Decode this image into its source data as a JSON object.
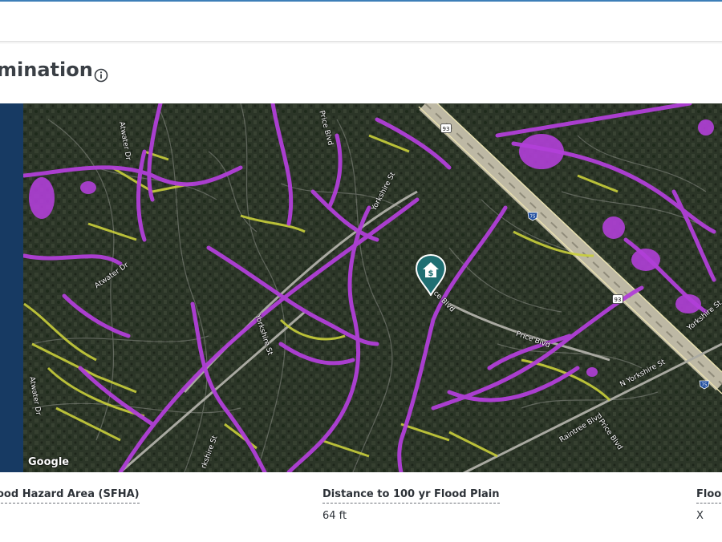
{
  "section": {
    "title": "mination"
  },
  "map": {
    "attribution": "Google",
    "road_labels": [
      "Atwater Dr",
      "Atwater Dr",
      "Atwater Dr",
      "Price Blvd",
      "Yorkshire St",
      "Yorkshire St",
      "rkshire St",
      "ce Blvd",
      "Price Blvd",
      "N Yorkshire St",
      "Raintree Blvd",
      "Price Blvd",
      "Yorkshire St"
    ],
    "highway_shields": [
      "93",
      "75",
      "93",
      "75"
    ],
    "colors": {
      "flood_zone": "#b13fd8",
      "minor_flood": "#c9cf3b",
      "pin": "#1f6f73"
    }
  },
  "fields": [
    {
      "label": "ood Hazard Area (SFHA)",
      "value": ""
    },
    {
      "label": "Distance to 100 yr Flood Plain",
      "value": "64 ft"
    },
    {
      "label": "Floo",
      "value": "X"
    }
  ]
}
